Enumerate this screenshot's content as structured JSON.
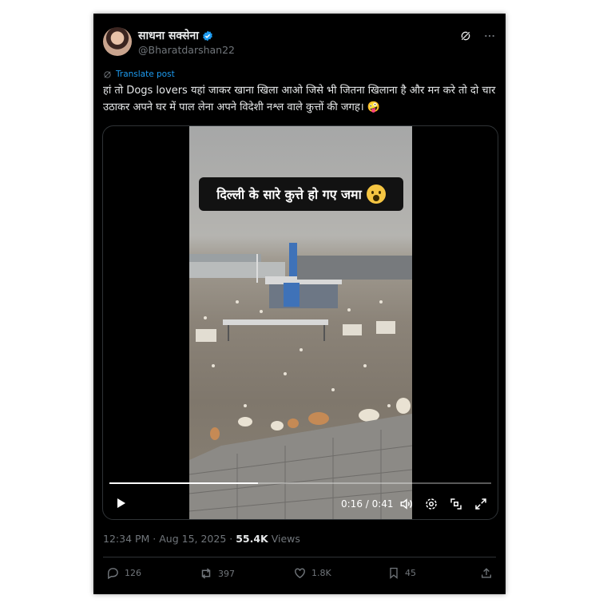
{
  "author": {
    "name": "साधना सक्सेना",
    "handle": "@Bharatdarshan22"
  },
  "translate_label": "Translate post",
  "tweet_text": "हां तो Dogs lovers यहां जाकर खाना खिला आओ जिसे भी जितना खिलाना है और मन करे तो दो चार उठाकर अपने घर में पाल लेना अपने विदेशी नश्ल वाले कुत्तों की जगह। 🤪",
  "video": {
    "caption": "दिल्ली के सारे कुत्ते हो गए जमा",
    "caption_emoji": "😱",
    "current_time": "0:16",
    "duration": "0:41",
    "time_display": "0:16 / 0:41",
    "progress": 0.39
  },
  "meta": {
    "timestamp": "12:34 PM · Aug 15, 2025 · ",
    "views_count": "55.4K",
    "views_label": " Views"
  },
  "actions": {
    "replies": "126",
    "reposts": "397",
    "likes": "1.8K",
    "bookmarks": "45"
  },
  "colors": {
    "background": "#000000",
    "text": "#e7e9ea",
    "secondary": "#71767b",
    "accent": "#1d9bf0"
  },
  "icons": [
    "verified-badge-icon",
    "grok-icon",
    "more-icon",
    "translate-icon",
    "play-icon",
    "volume-icon",
    "settings-icon",
    "picture-in-picture-icon",
    "fullscreen-icon",
    "reply-icon",
    "repost-icon",
    "like-icon",
    "bookmark-icon",
    "share-icon"
  ]
}
